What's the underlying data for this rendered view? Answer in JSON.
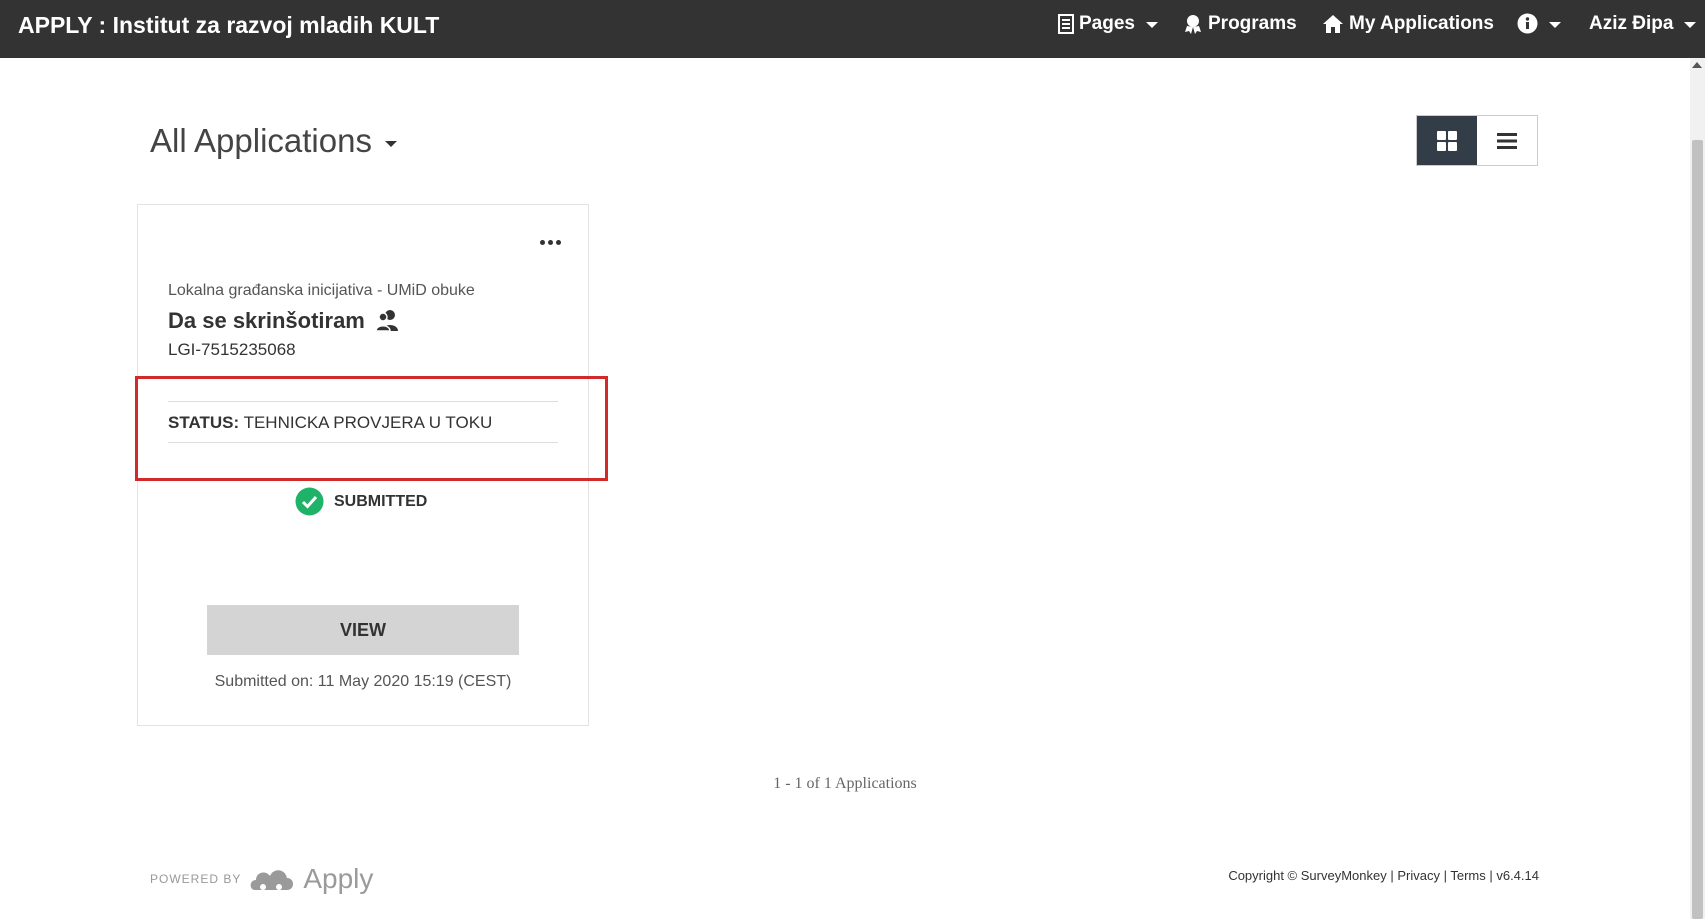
{
  "header": {
    "brand": "APPLY : Institut za razvoj mladih KULT",
    "nav": {
      "pages": "Pages",
      "programs": "Programs",
      "my_applications": "My Applications",
      "user": "Aziz Đipa"
    }
  },
  "main": {
    "title": "All Applications",
    "card": {
      "program": "Lokalna građanska inicijativa - UMiD obuke",
      "name": "Da se skrinšotiram",
      "id": "LGI-7515235068",
      "status_label": "STATUS:",
      "status_value": "TEHNICKA PROVJERA U TOKU",
      "submitted_badge": "SUBMITTED",
      "view_button": "VIEW",
      "submitted_on": "Submitted on: 11 May 2020 15:19 (CEST)"
    },
    "pagination": "1 - 1 of 1 Applications"
  },
  "footer": {
    "powered_by": "POWERED BY",
    "powered_brand": "Apply",
    "copyright": "Copyright © SurveyMonkey",
    "privacy": "Privacy",
    "terms": "Terms",
    "version": "v6.4.14"
  },
  "colors": {
    "topbar": "#333333",
    "success_green": "#1fb36a",
    "highlight_red": "#d22a2a",
    "toggle_active": "#333d47"
  }
}
